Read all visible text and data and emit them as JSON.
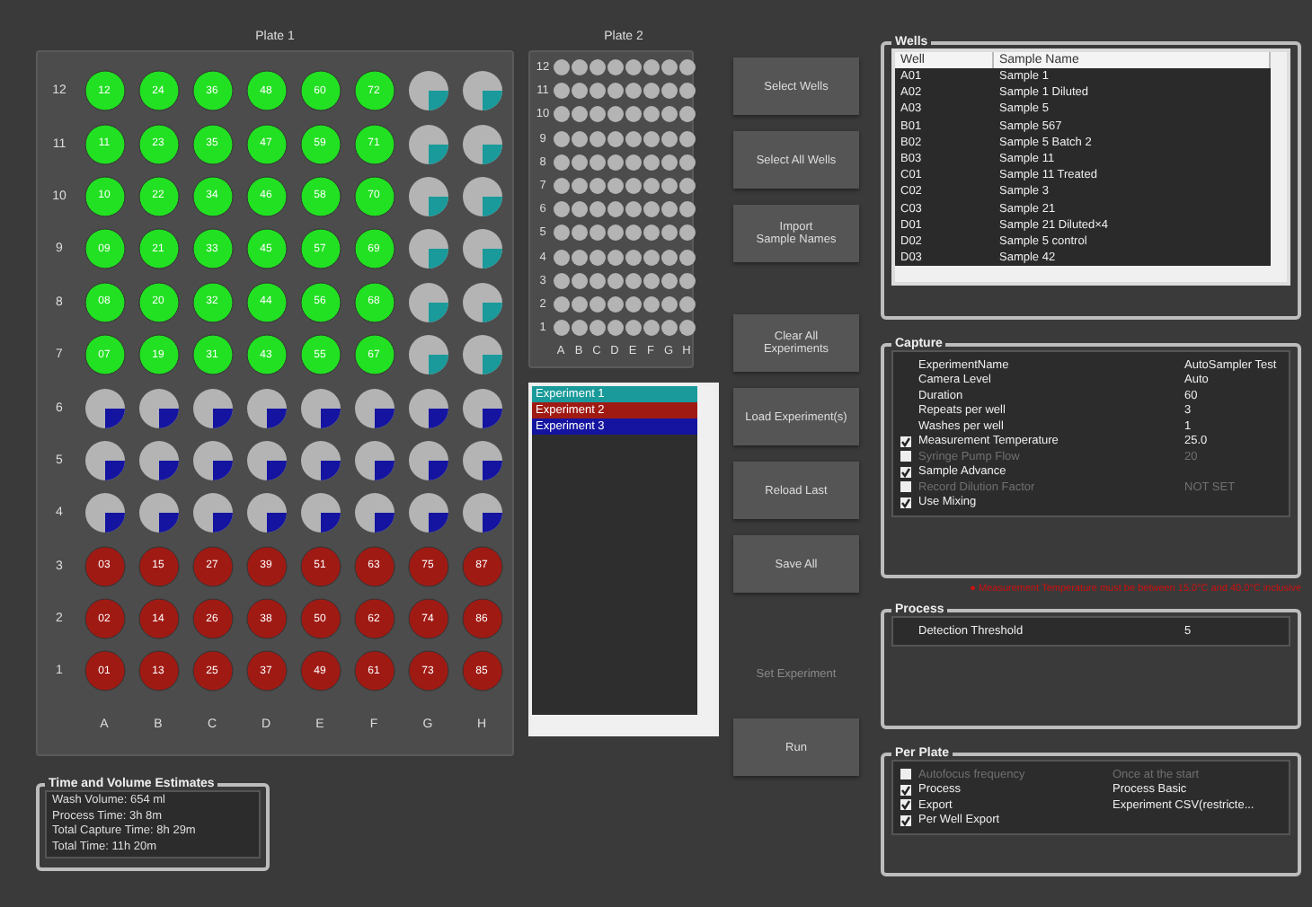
{
  "plate1": {
    "title": "Plate 1",
    "columns": [
      "A",
      "B",
      "C",
      "D",
      "E",
      "F",
      "G",
      "H"
    ],
    "rows": [
      {
        "label": "12",
        "wells": [
          {
            "kind": "filled",
            "color": "#22e022",
            "label": "12"
          },
          {
            "kind": "filled",
            "color": "#22e022",
            "label": "24"
          },
          {
            "kind": "filled",
            "color": "#22e022",
            "label": "36"
          },
          {
            "kind": "filled",
            "color": "#22e022",
            "label": "48"
          },
          {
            "kind": "filled",
            "color": "#22e022",
            "label": "60"
          },
          {
            "kind": "filled",
            "color": "#22e022",
            "label": "72"
          },
          {
            "kind": "pie",
            "color": "#1a9a9a"
          },
          {
            "kind": "pie",
            "color": "#1a9a9a"
          }
        ]
      },
      {
        "label": "11",
        "wells": [
          {
            "kind": "filled",
            "color": "#22e022",
            "label": "11"
          },
          {
            "kind": "filled",
            "color": "#22e022",
            "label": "23"
          },
          {
            "kind": "filled",
            "color": "#22e022",
            "label": "35"
          },
          {
            "kind": "filled",
            "color": "#22e022",
            "label": "47"
          },
          {
            "kind": "filled",
            "color": "#22e022",
            "label": "59"
          },
          {
            "kind": "filled",
            "color": "#22e022",
            "label": "71"
          },
          {
            "kind": "pie",
            "color": "#1a9a9a"
          },
          {
            "kind": "pie",
            "color": "#1a9a9a"
          }
        ]
      },
      {
        "label": "10",
        "wells": [
          {
            "kind": "filled",
            "color": "#22e022",
            "label": "10"
          },
          {
            "kind": "filled",
            "color": "#22e022",
            "label": "22"
          },
          {
            "kind": "filled",
            "color": "#22e022",
            "label": "34"
          },
          {
            "kind": "filled",
            "color": "#22e022",
            "label": "46"
          },
          {
            "kind": "filled",
            "color": "#22e022",
            "label": "58"
          },
          {
            "kind": "filled",
            "color": "#22e022",
            "label": "70"
          },
          {
            "kind": "pie",
            "color": "#1a9a9a"
          },
          {
            "kind": "pie",
            "color": "#1a9a9a"
          }
        ]
      },
      {
        "label": "9",
        "wells": [
          {
            "kind": "filled",
            "color": "#22e022",
            "label": "09"
          },
          {
            "kind": "filled",
            "color": "#22e022",
            "label": "21"
          },
          {
            "kind": "filled",
            "color": "#22e022",
            "label": "33"
          },
          {
            "kind": "filled",
            "color": "#22e022",
            "label": "45"
          },
          {
            "kind": "filled",
            "color": "#22e022",
            "label": "57"
          },
          {
            "kind": "filled",
            "color": "#22e022",
            "label": "69"
          },
          {
            "kind": "pie",
            "color": "#1a9a9a"
          },
          {
            "kind": "pie",
            "color": "#1a9a9a"
          }
        ]
      },
      {
        "label": "8",
        "wells": [
          {
            "kind": "filled",
            "color": "#22e022",
            "label": "08"
          },
          {
            "kind": "filled",
            "color": "#22e022",
            "label": "20"
          },
          {
            "kind": "filled",
            "color": "#22e022",
            "label": "32"
          },
          {
            "kind": "filled",
            "color": "#22e022",
            "label": "44"
          },
          {
            "kind": "filled",
            "color": "#22e022",
            "label": "56"
          },
          {
            "kind": "filled",
            "color": "#22e022",
            "label": "68"
          },
          {
            "kind": "pie",
            "color": "#1a9a9a"
          },
          {
            "kind": "pie",
            "color": "#1a9a9a"
          }
        ]
      },
      {
        "label": "7",
        "wells": [
          {
            "kind": "filled",
            "color": "#22e022",
            "label": "07"
          },
          {
            "kind": "filled",
            "color": "#22e022",
            "label": "19"
          },
          {
            "kind": "filled",
            "color": "#22e022",
            "label": "31"
          },
          {
            "kind": "filled",
            "color": "#22e022",
            "label": "43"
          },
          {
            "kind": "filled",
            "color": "#22e022",
            "label": "55"
          },
          {
            "kind": "filled",
            "color": "#22e022",
            "label": "67"
          },
          {
            "kind": "pie",
            "color": "#1a9a9a"
          },
          {
            "kind": "pie",
            "color": "#1a9a9a"
          }
        ]
      },
      {
        "label": "6",
        "wells": [
          {
            "kind": "pie",
            "color": "#1414a0"
          },
          {
            "kind": "pie",
            "color": "#1414a0"
          },
          {
            "kind": "pie",
            "color": "#1414a0"
          },
          {
            "kind": "pie",
            "color": "#1414a0"
          },
          {
            "kind": "pie",
            "color": "#1414a0"
          },
          {
            "kind": "pie",
            "color": "#1414a0"
          },
          {
            "kind": "pie",
            "color": "#1414a0"
          },
          {
            "kind": "pie",
            "color": "#1414a0"
          }
        ]
      },
      {
        "label": "5",
        "wells": [
          {
            "kind": "pie",
            "color": "#1414a0"
          },
          {
            "kind": "pie",
            "color": "#1414a0"
          },
          {
            "kind": "pie",
            "color": "#1414a0"
          },
          {
            "kind": "pie",
            "color": "#1414a0"
          },
          {
            "kind": "pie",
            "color": "#1414a0"
          },
          {
            "kind": "pie",
            "color": "#1414a0"
          },
          {
            "kind": "pie",
            "color": "#1414a0"
          },
          {
            "kind": "pie",
            "color": "#1414a0"
          }
        ]
      },
      {
        "label": "4",
        "wells": [
          {
            "kind": "pie",
            "color": "#1414a0"
          },
          {
            "kind": "pie",
            "color": "#1414a0"
          },
          {
            "kind": "pie",
            "color": "#1414a0"
          },
          {
            "kind": "pie",
            "color": "#1414a0"
          },
          {
            "kind": "pie",
            "color": "#1414a0"
          },
          {
            "kind": "pie",
            "color": "#1414a0"
          },
          {
            "kind": "pie",
            "color": "#1414a0"
          },
          {
            "kind": "pie",
            "color": "#1414a0"
          }
        ]
      },
      {
        "label": "3",
        "wells": [
          {
            "kind": "filled",
            "color": "#a01a14",
            "label": "03"
          },
          {
            "kind": "filled",
            "color": "#a01a14",
            "label": "15"
          },
          {
            "kind": "filled",
            "color": "#a01a14",
            "label": "27"
          },
          {
            "kind": "filled",
            "color": "#a01a14",
            "label": "39"
          },
          {
            "kind": "filled",
            "color": "#a01a14",
            "label": "51"
          },
          {
            "kind": "filled",
            "color": "#a01a14",
            "label": "63"
          },
          {
            "kind": "filled",
            "color": "#a01a14",
            "label": "75"
          },
          {
            "kind": "filled",
            "color": "#a01a14",
            "label": "87"
          }
        ]
      },
      {
        "label": "2",
        "wells": [
          {
            "kind": "filled",
            "color": "#a01a14",
            "label": "02"
          },
          {
            "kind": "filled",
            "color": "#a01a14",
            "label": "14"
          },
          {
            "kind": "filled",
            "color": "#a01a14",
            "label": "26"
          },
          {
            "kind": "filled",
            "color": "#a01a14",
            "label": "38"
          },
          {
            "kind": "filled",
            "color": "#a01a14",
            "label": "50"
          },
          {
            "kind": "filled",
            "color": "#a01a14",
            "label": "62"
          },
          {
            "kind": "filled",
            "color": "#a01a14",
            "label": "74"
          },
          {
            "kind": "filled",
            "color": "#a01a14",
            "label": "86"
          }
        ]
      },
      {
        "label": "1",
        "wells": [
          {
            "kind": "filled",
            "color": "#a01a14",
            "label": "01"
          },
          {
            "kind": "filled",
            "color": "#a01a14",
            "label": "13"
          },
          {
            "kind": "filled",
            "color": "#a01a14",
            "label": "25"
          },
          {
            "kind": "filled",
            "color": "#a01a14",
            "label": "37"
          },
          {
            "kind": "filled",
            "color": "#a01a14",
            "label": "49"
          },
          {
            "kind": "filled",
            "color": "#a01a14",
            "label": "61"
          },
          {
            "kind": "filled",
            "color": "#a01a14",
            "label": "73"
          },
          {
            "kind": "filled",
            "color": "#a01a14",
            "label": "85"
          }
        ]
      }
    ]
  },
  "plate2": {
    "title": "Plate 2",
    "columns": [
      "A",
      "B",
      "C",
      "D",
      "E",
      "F",
      "G",
      "H"
    ],
    "rows": [
      "12",
      "11",
      "10",
      "9",
      "8",
      "7",
      "6",
      "5",
      "4",
      "3",
      "2",
      "1"
    ]
  },
  "experiments": [
    {
      "name": "Experiment 1",
      "color": "#1a9a9a"
    },
    {
      "name": "Experiment 2",
      "color": "#a01a14"
    },
    {
      "name": "Experiment 3",
      "color": "#1414a0"
    }
  ],
  "button_groups": [
    [
      {
        "label": "Select Wells",
        "disabled": false
      },
      {
        "label": "Select All Wells",
        "disabled": false
      },
      {
        "label": "Import\nSample Names",
        "disabled": false
      }
    ],
    [
      {
        "label": "Clear All\nExperiments",
        "disabled": false
      },
      {
        "label": "Load Experiment(s)",
        "disabled": false
      },
      {
        "label": "Reload Last",
        "disabled": false
      },
      {
        "label": "Save All",
        "disabled": false
      }
    ],
    [
      {
        "label": "Set Experiment",
        "disabled": true
      },
      {
        "label": "Run",
        "disabled": false
      }
    ]
  ],
  "time_estimates": {
    "title": "Time and Volume Estimates",
    "lines": [
      "Wash Volume: 654 ml",
      "Process Time: 3h 8m",
      "Total Capture Time: 8h 29m",
      "Total Time: 11h 20m"
    ]
  },
  "wells": {
    "title": "Wells",
    "columns": [
      "Well",
      "Sample Name"
    ],
    "rows": [
      [
        "A01",
        "Sample 1"
      ],
      [
        "A02",
        "Sample 1 Diluted"
      ],
      [
        "A03",
        "Sample 5"
      ],
      [
        "B01",
        "Sample 567"
      ],
      [
        "B02",
        "Sample 5 Batch 2"
      ],
      [
        "B03",
        "Sample 11"
      ],
      [
        "C01",
        "Sample 11 Treated"
      ],
      [
        "C02",
        "Sample 3"
      ],
      [
        "C03",
        "Sample 21"
      ],
      [
        "D01",
        "Sample 21 Diluted×4"
      ],
      [
        "D02",
        "Sample 5 control"
      ],
      [
        "D03",
        "Sample 42"
      ]
    ]
  },
  "capture": {
    "title": "Capture",
    "rows": [
      {
        "kind": "plain",
        "name": "ExperimentName",
        "value": "AutoSampler Test"
      },
      {
        "kind": "plain",
        "name": "Camera Level",
        "value": "Auto"
      },
      {
        "kind": "plain",
        "name": "Duration",
        "value": "60"
      },
      {
        "kind": "plain",
        "name": "Repeats per well",
        "value": "3"
      },
      {
        "kind": "plain",
        "name": "Washes per well",
        "value": "1"
      },
      {
        "kind": "check",
        "name": "Measurement Temperature",
        "value": "25.0",
        "checked": true,
        "disabled": false
      },
      {
        "kind": "check",
        "name": "Syringe Pump Flow",
        "value": "20",
        "checked": false,
        "disabled": true
      },
      {
        "kind": "check",
        "name": "Sample Advance",
        "checked": true,
        "disabled": false
      },
      {
        "kind": "check",
        "name": "Record Dilution Factor",
        "value": "NOT SET",
        "checked": false,
        "disabled": true
      },
      {
        "kind": "check",
        "name": "Use Mixing",
        "checked": true,
        "disabled": false
      }
    ],
    "warning": "● Measurement Temperature must be between 15.0°C and 40.0°C inclusive"
  },
  "process": {
    "title": "Process",
    "rows": [
      {
        "name": "Detection Threshold",
        "value": "5"
      }
    ]
  },
  "per_plate": {
    "title": "Per Plate",
    "rows": [
      {
        "name": "Autofocus frequency",
        "value": "Once at the start",
        "checked": false,
        "disabled": true
      },
      {
        "name": "Process",
        "value": "Process Basic",
        "checked": true,
        "disabled": false
      },
      {
        "name": "Export",
        "value": "Experiment CSV(restricte...",
        "checked": true,
        "disabled": false
      },
      {
        "name": "Per Well Export",
        "checked": true,
        "disabled": false
      }
    ]
  }
}
